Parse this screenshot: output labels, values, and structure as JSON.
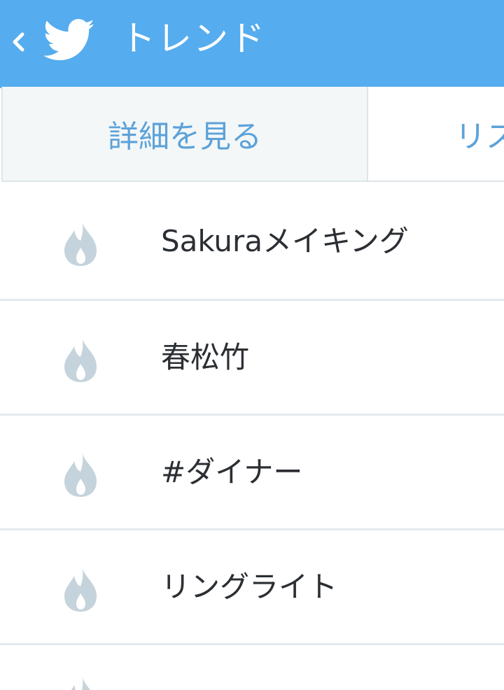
{
  "header": {
    "title": "トレンド",
    "back_icon": "chevron-left-icon",
    "logo_icon": "twitter-bird-icon",
    "background_color": "#55acee"
  },
  "tabs": [
    {
      "label": "詳細を見る",
      "selected": true
    },
    {
      "label": "リス",
      "selected": false
    }
  ],
  "trends": [
    {
      "label": "Sakuraメイキング",
      "icon": "flame-icon"
    },
    {
      "label": "春松竹",
      "icon": "flame-icon"
    },
    {
      "label": "#ダイナー",
      "icon": "flame-icon"
    },
    {
      "label": "リングライト",
      "icon": "flame-icon"
    }
  ],
  "colors": {
    "accent": "#55acee",
    "tab_text": "#5da2d8",
    "flame": "#c5d3dc",
    "trend_text": "#2b2f33"
  }
}
